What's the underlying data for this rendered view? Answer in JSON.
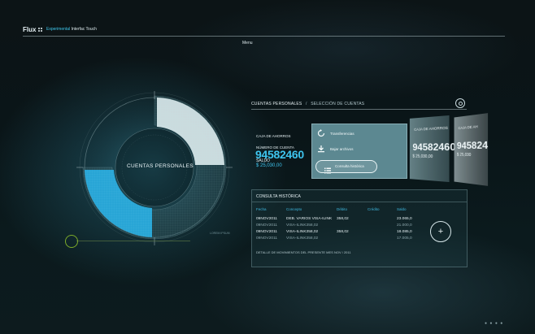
{
  "header": {
    "brand": "Flux",
    "subtitle_accent": "Experimental",
    "subtitle_rest": "Interfac Touch",
    "menu_label": "Menu"
  },
  "ring": {
    "label": "CUENTAS PERSONALES",
    "side_text": "LOREM IPSUM",
    "accent_color": "#29aee2"
  },
  "panel": {
    "breadcrumb_1": "CUENTAS PERSONALES",
    "breadcrumb_sep": "/",
    "breadcrumb_2": "SELECCIÓN DE CUENTAS"
  },
  "account": {
    "type": "CAJA DE AHORROS",
    "number_label": "NÚMERO DE CUENTA",
    "number": "94582460",
    "balance_label": "SALDO",
    "balance": "$ 25,030,00"
  },
  "actions": [
    {
      "label": "Transferencias",
      "icon": "refresh-circle-icon"
    },
    {
      "label": "Bajar archivos",
      "icon": "download-icon"
    },
    {
      "label": "Consulta histórica",
      "icon": "list-icon"
    }
  ],
  "other_cards": [
    {
      "type": "CAJA DE AHORROS",
      "number": "94582460",
      "balance": "$ 25,030,00"
    },
    {
      "type": "CAJA DE AH",
      "number": "945824",
      "balance": "$ 25,030"
    }
  ],
  "history": {
    "title": "CONSULTA HISTÓRICA",
    "columns": [
      "Fecha",
      "Concepto",
      "Débito",
      "Crédito",
      "Saldo"
    ],
    "rows": [
      {
        "fecha": "09NOV2011",
        "concepto": "DEB. VARIOS VISA-ILINK",
        "debito": "358,02",
        "credito": "",
        "saldo": "23.065,0"
      },
      {
        "fecha": "09NOV2011",
        "concepto": "VISA-ILINK358,02",
        "debito": "",
        "credito": "",
        "saldo": "21.000,0"
      },
      {
        "fecha": "09NOV2011",
        "concepto": "VISA-ILINK358,02",
        "debito": "358,02",
        "credito": "",
        "saldo": "18.085,0"
      },
      {
        "fecha": "09NOV2011",
        "concepto": "VISA-ILINK358,02",
        "debito": "",
        "credito": "",
        "saldo": "17.005,0"
      }
    ],
    "footer": "DETALLE DE MOVIMIENTOS DEL PRESENTE MES NOV / 2011",
    "add_label": "+"
  },
  "pagination_dots": "● ● ● ●"
}
